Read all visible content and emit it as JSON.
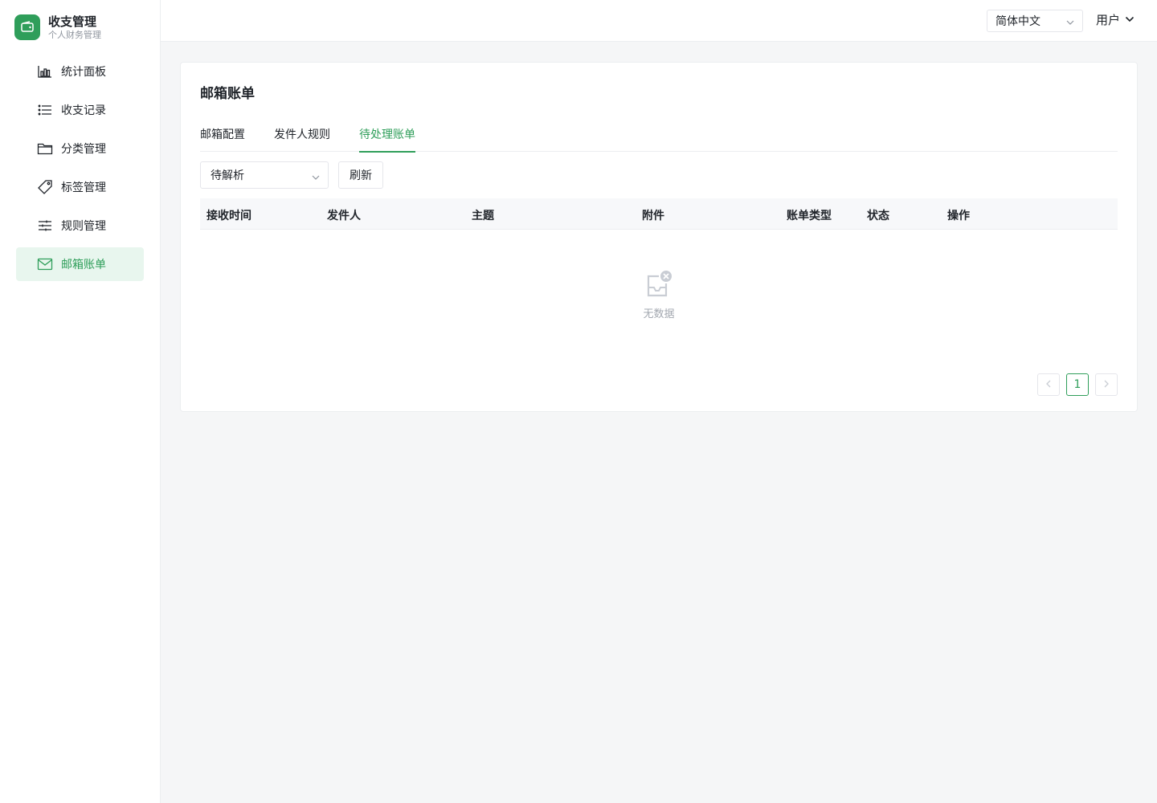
{
  "brand": {
    "title": "收支管理",
    "subtitle": "个人财务管理"
  },
  "sidebar": {
    "items": [
      {
        "label": "统计面板",
        "icon": "bar-chart-icon"
      },
      {
        "label": "收支记录",
        "icon": "list-icon"
      },
      {
        "label": "分类管理",
        "icon": "folder-icon"
      },
      {
        "label": "标签管理",
        "icon": "tag-icon"
      },
      {
        "label": "规则管理",
        "icon": "sliders-icon"
      },
      {
        "label": "邮箱账单",
        "icon": "mail-icon",
        "active": true
      }
    ]
  },
  "header": {
    "language": "简体中文",
    "user": "用户"
  },
  "page": {
    "title": "邮箱账单"
  },
  "tabs": [
    {
      "label": "邮箱配置"
    },
    {
      "label": "发件人规则"
    },
    {
      "label": "待处理账单",
      "active": true
    }
  ],
  "filters": {
    "status_value": "待解析",
    "refresh_label": "刷新"
  },
  "table": {
    "columns": [
      "接收时间",
      "发件人",
      "主题",
      "附件",
      "账单类型",
      "状态",
      "操作"
    ],
    "rows": [],
    "empty_text": "无数据"
  },
  "pagination": {
    "current_page": "1",
    "prev_symbol": "‹",
    "next_symbol": "›"
  },
  "colors": {
    "accent": "#2f9e5a",
    "active_bg": "#e8f6ee"
  }
}
